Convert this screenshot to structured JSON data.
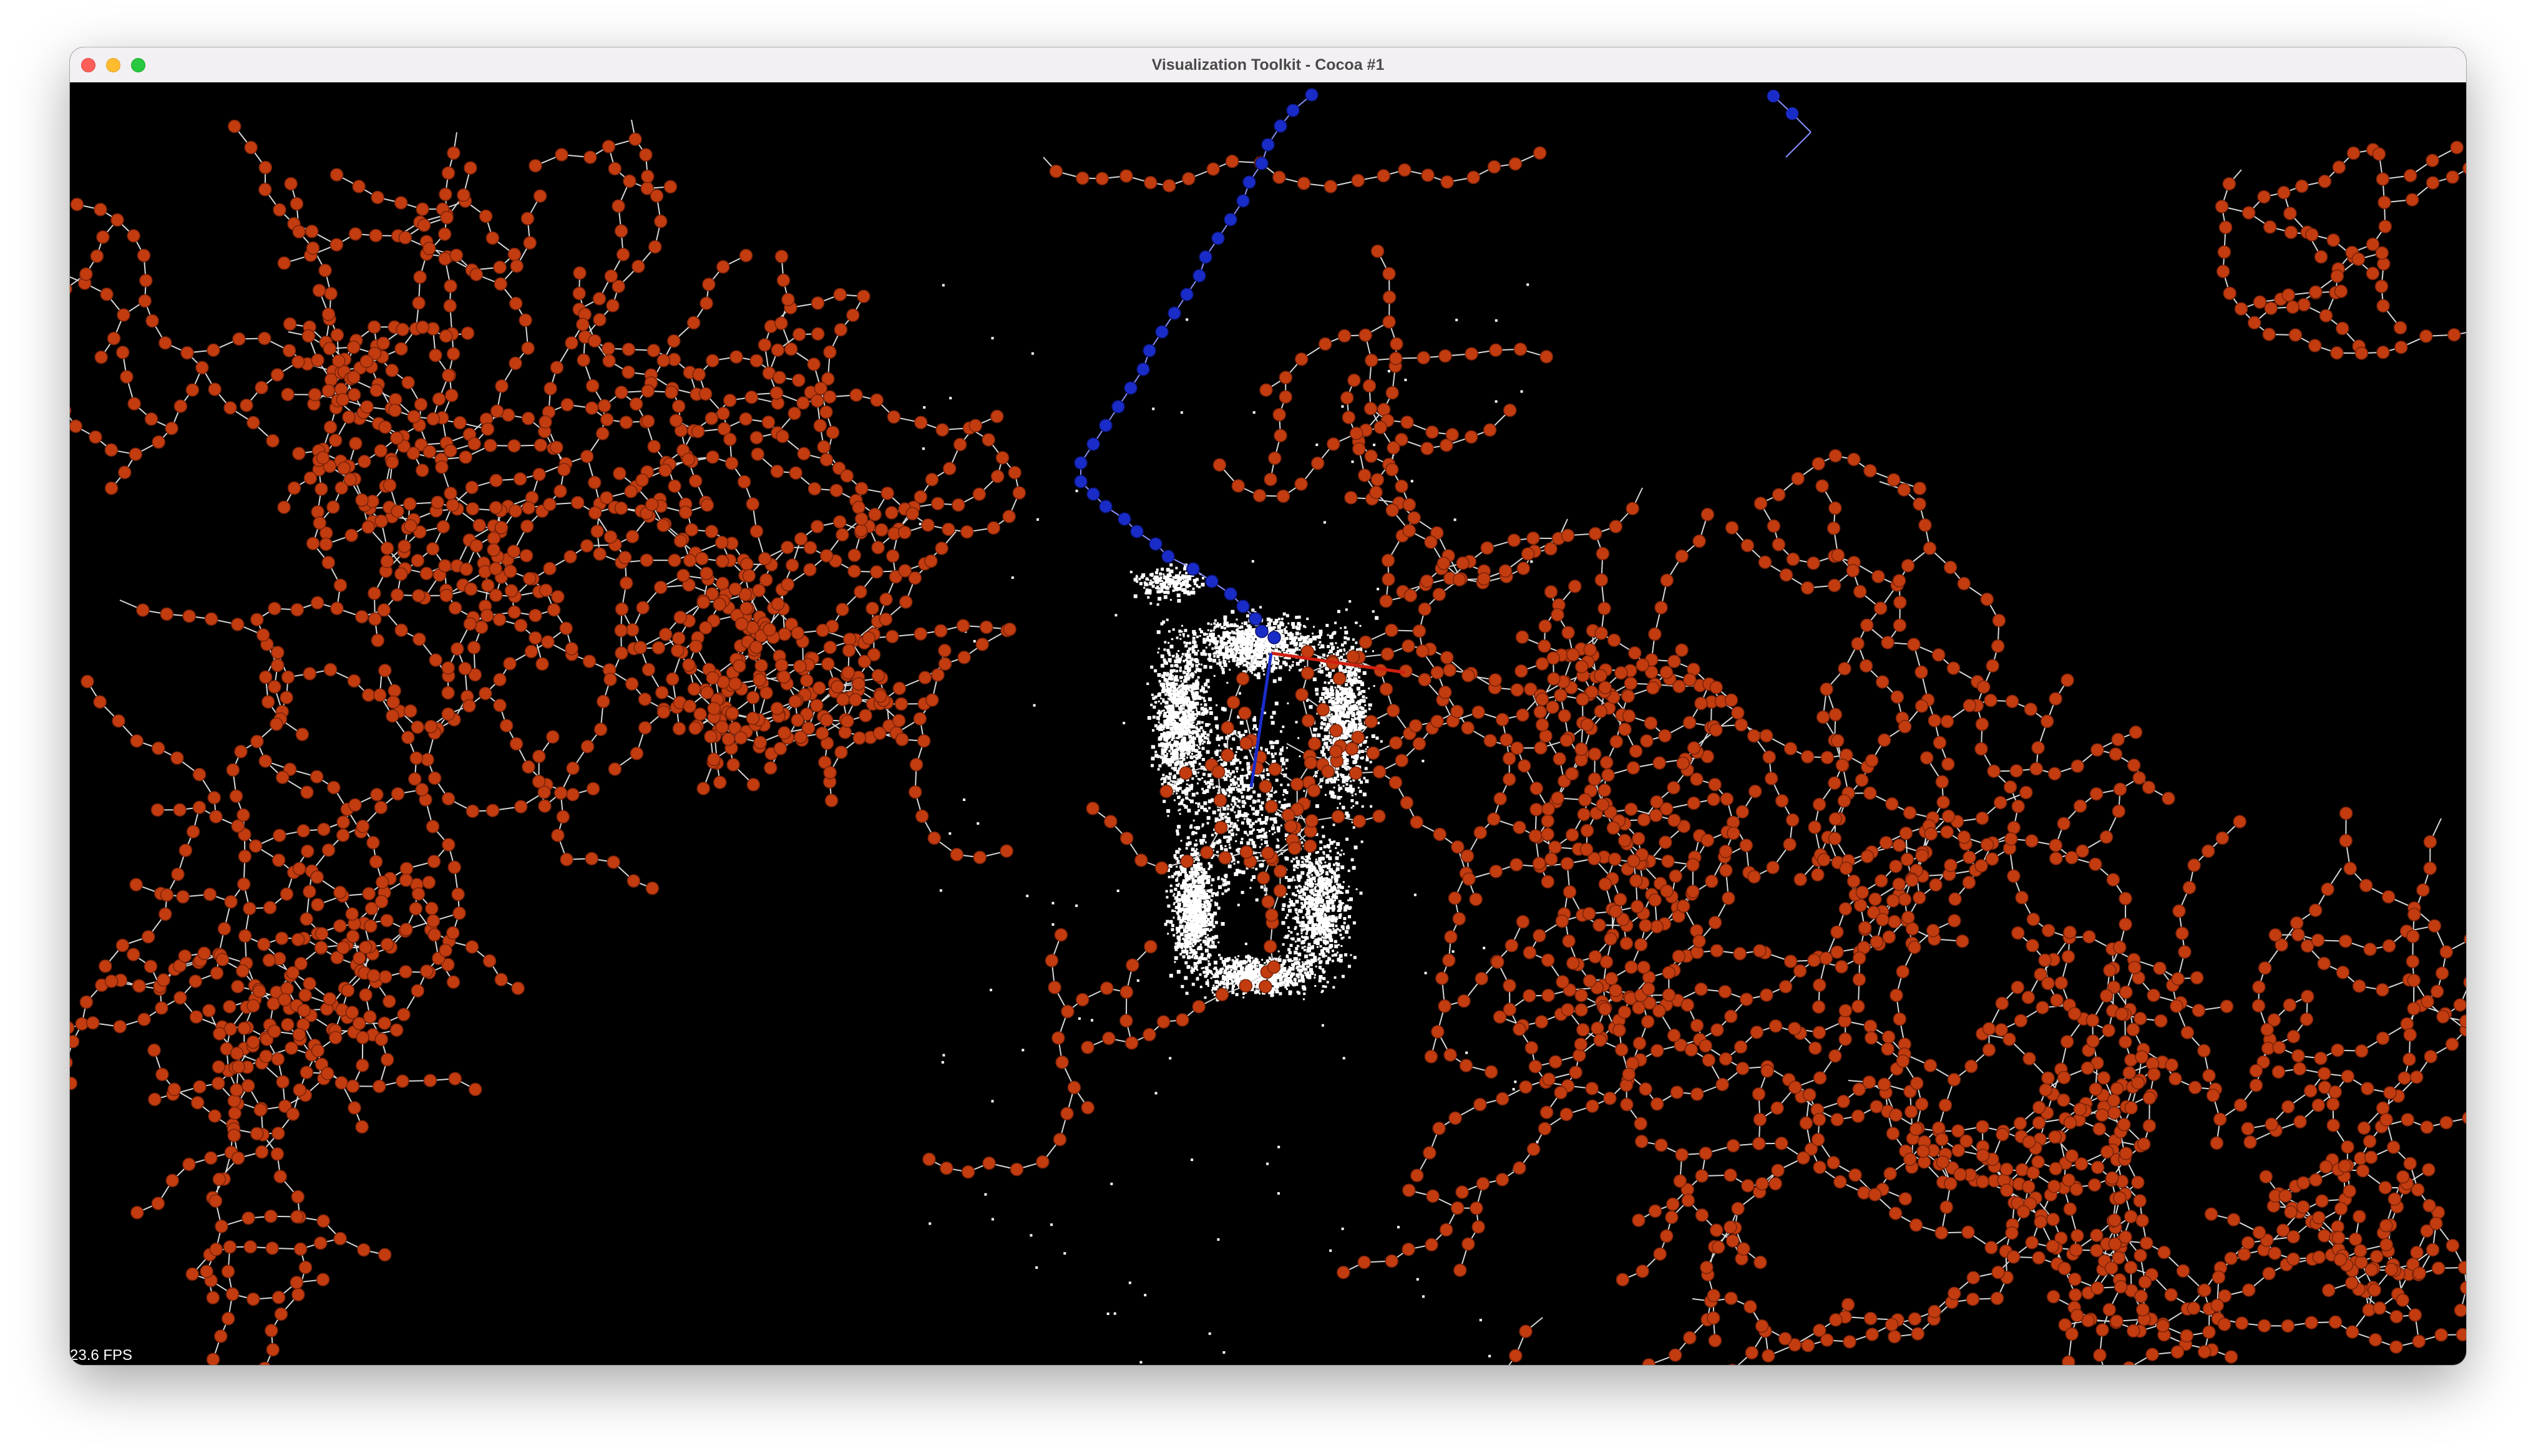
{
  "window": {
    "title": "Visualization Toolkit - Cocoa #1"
  },
  "render": {
    "fps_label": "23.6 FPS",
    "background_color": "#000000",
    "point_cloud_color": "#ffffff",
    "graph_node_color": "#c23c10",
    "graph_edge_color": "#d8d8d8",
    "highlight_path_color": "#1a2cc8",
    "axis_x_color": "#d02010",
    "axis_y_color": "#1a2cc8"
  }
}
